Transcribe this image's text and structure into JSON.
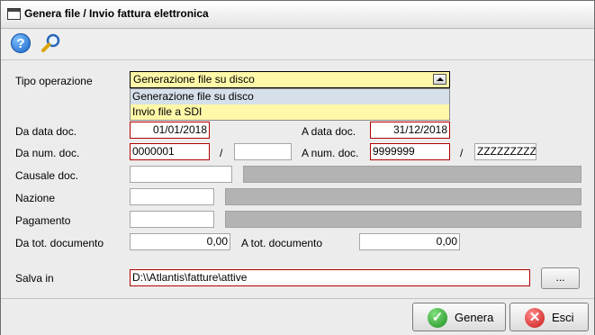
{
  "window": {
    "title": "Genera file / Invio fattura elettronica"
  },
  "toolbar": {
    "help_icon": "help-icon",
    "search_icon": "magnifier-icon"
  },
  "form": {
    "tipo_operazione": {
      "label": "Tipo operazione",
      "value": "Generazione file su disco",
      "options": [
        "Generazione file su disco",
        "Invio file a SDI"
      ]
    },
    "da_data": {
      "label": "Da data doc.",
      "value": "01/01/2018"
    },
    "a_data": {
      "label": "A data doc.",
      "value": "31/12/2018"
    },
    "da_num": {
      "label": "Da num. doc.",
      "value": "0000001",
      "suffix": ""
    },
    "a_num": {
      "label": "A num. doc.",
      "value": "9999999",
      "suffix": "ZZZZZZZZZZ"
    },
    "slash": "/",
    "causale": {
      "label": "Causale doc.",
      "value": ""
    },
    "nazione": {
      "label": "Nazione",
      "value": ""
    },
    "pagamento": {
      "label": "Pagamento",
      "value": ""
    },
    "da_tot": {
      "label": "Da tot. documento",
      "value": "0,00"
    },
    "a_tot": {
      "label": "A tot. documento",
      "value": "0,00"
    },
    "salva_in": {
      "label": "Salva in",
      "value": "D:\\\\Atlantis\\fatture\\attive",
      "browse": "..."
    }
  },
  "buttons": {
    "genera": "Genera",
    "esci": "Esci"
  },
  "colors": {
    "required_border": "#b40000",
    "combo_bg": "#fff8a8",
    "genera_icon": "#2a9d2a",
    "esci_icon": "#d62020"
  }
}
